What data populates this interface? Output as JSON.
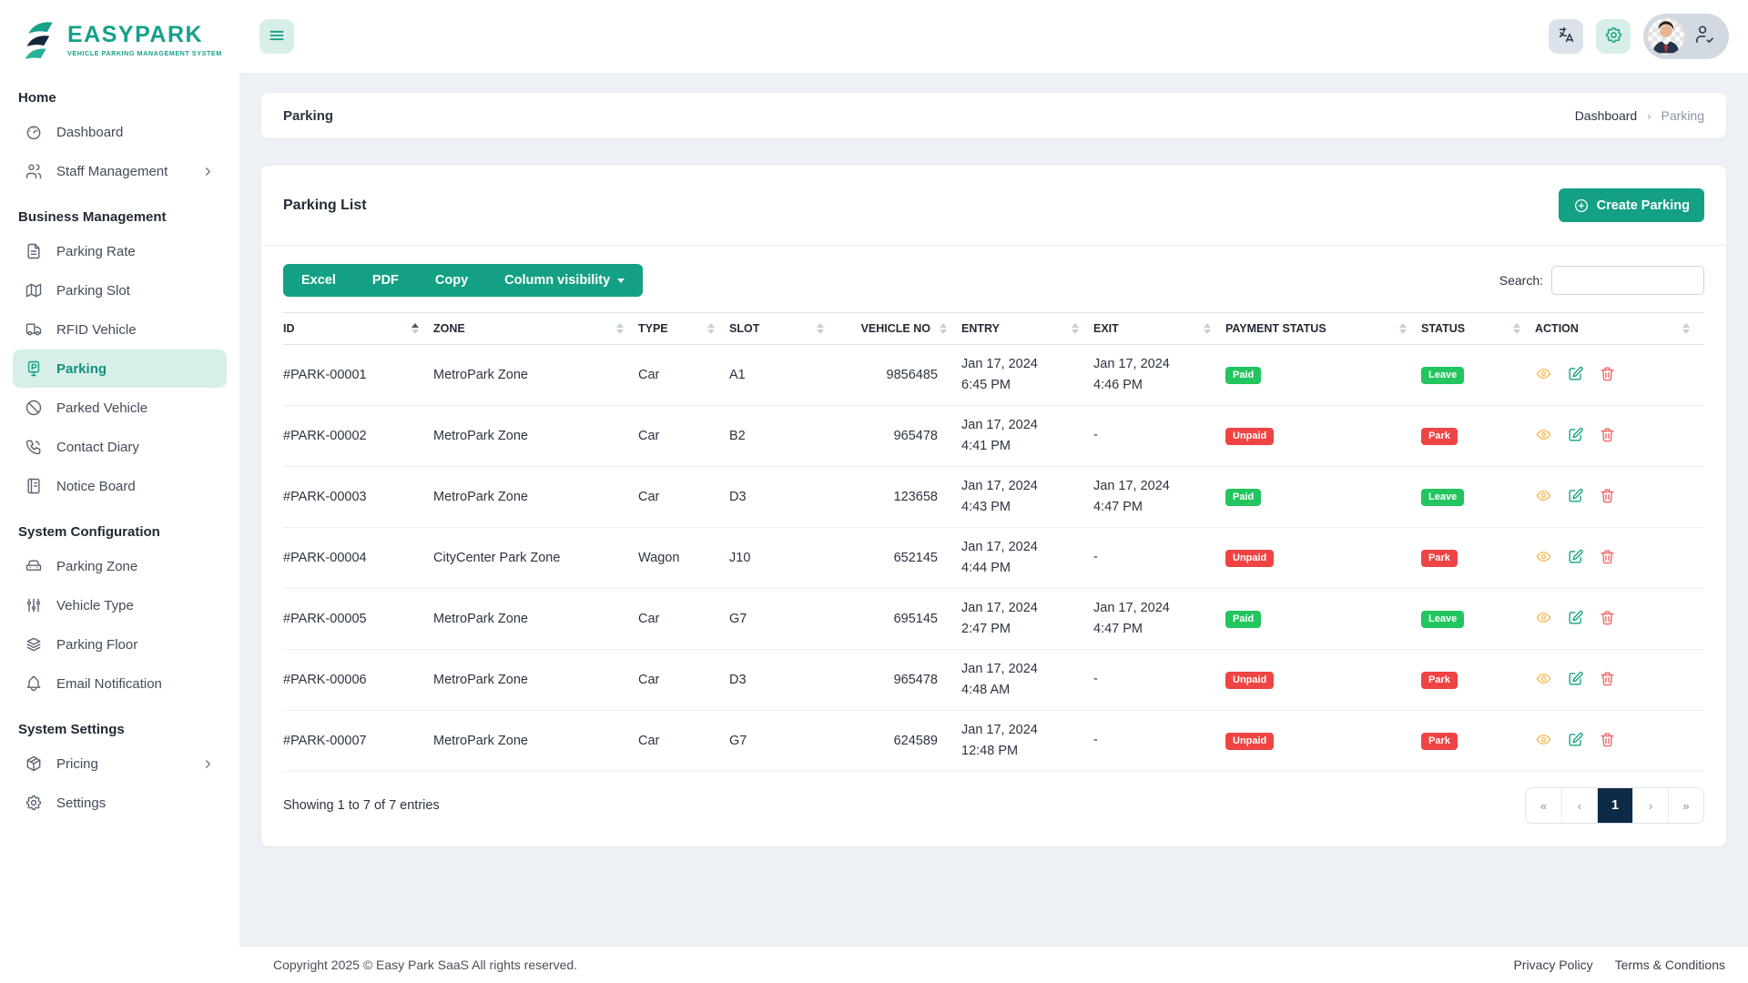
{
  "brand": {
    "name": "EASYPARK",
    "tagline": "VEHICLE PARKING MANAGEMENT SYSTEM"
  },
  "sidebar": {
    "sections": [
      {
        "label": "Home",
        "items": [
          {
            "label": "Dashboard",
            "icon": "dashboard-icon"
          },
          {
            "label": "Staff Management",
            "icon": "users-icon",
            "chevron": true
          }
        ]
      },
      {
        "label": "Business Management",
        "items": [
          {
            "label": "Parking Rate",
            "icon": "file-text-icon"
          },
          {
            "label": "Parking Slot",
            "icon": "map-icon"
          },
          {
            "label": "RFID Vehicle",
            "icon": "truck-icon"
          },
          {
            "label": "Parking",
            "icon": "parking-meter-icon",
            "active": true
          },
          {
            "label": "Parked Vehicle",
            "icon": "ban-icon"
          },
          {
            "label": "Contact Diary",
            "icon": "phone-icon"
          },
          {
            "label": "Notice Board",
            "icon": "notice-board-icon"
          }
        ]
      },
      {
        "label": "System Configuration",
        "items": [
          {
            "label": "Parking Zone",
            "icon": "car-icon"
          },
          {
            "label": "Vehicle Type",
            "icon": "sliders-icon"
          },
          {
            "label": "Parking Floor",
            "icon": "layers-icon"
          },
          {
            "label": "Email Notification",
            "icon": "bell-icon"
          }
        ]
      },
      {
        "label": "System Settings",
        "items": [
          {
            "label": "Pricing",
            "icon": "package-icon",
            "chevron": true
          },
          {
            "label": "Settings",
            "icon": "gear-icon"
          }
        ]
      }
    ]
  },
  "breadcrumb": {
    "page_title": "Parking",
    "items": [
      "Dashboard",
      "Parking"
    ]
  },
  "parking_list": {
    "title": "Parking List",
    "create_button": "Create Parking",
    "export_buttons": [
      "Excel",
      "PDF",
      "Copy"
    ],
    "column_visibility_button": "Column visibility",
    "search_label": "Search:",
    "search_value": ""
  },
  "table": {
    "columns": [
      {
        "label": "ID",
        "sorted": "asc"
      },
      {
        "label": "ZONE",
        "sorted": "none"
      },
      {
        "label": "TYPE",
        "sorted": "none"
      },
      {
        "label": "SLOT",
        "sorted": "none"
      },
      {
        "label": "VEHICLE NO",
        "sorted": "none"
      },
      {
        "label": "ENTRY",
        "sorted": "none"
      },
      {
        "label": "EXIT",
        "sorted": "none"
      },
      {
        "label": "PAYMENT STATUS",
        "sorted": "none"
      },
      {
        "label": "STATUS",
        "sorted": "none"
      },
      {
        "label": "ACTION",
        "sorted": "none"
      }
    ],
    "rows": [
      {
        "id": "#PARK-00001",
        "zone": "MetroPark Zone",
        "type": "Car",
        "slot": "A1",
        "vehicle_no": "9856485",
        "entry": [
          "Jan 17, 2024",
          "6:45 PM"
        ],
        "exit": [
          "Jan 17, 2024",
          "4:46 PM"
        ],
        "payment": "Paid",
        "status": "Leave"
      },
      {
        "id": "#PARK-00002",
        "zone": "MetroPark Zone",
        "type": "Car",
        "slot": "B2",
        "vehicle_no": "965478",
        "entry": [
          "Jan 17, 2024",
          "4:41 PM"
        ],
        "exit": [
          "-"
        ],
        "payment": "Unpaid",
        "status": "Park"
      },
      {
        "id": "#PARK-00003",
        "zone": "MetroPark Zone",
        "type": "Car",
        "slot": "D3",
        "vehicle_no": "123658",
        "entry": [
          "Jan 17, 2024",
          "4:43 PM"
        ],
        "exit": [
          "Jan 17, 2024",
          "4:47 PM"
        ],
        "payment": "Paid",
        "status": "Leave"
      },
      {
        "id": "#PARK-00004",
        "zone": "CityCenter Park Zone",
        "type": "Wagon",
        "slot": "J10",
        "vehicle_no": "652145",
        "entry": [
          "Jan 17, 2024",
          "4:44 PM"
        ],
        "exit": [
          "-"
        ],
        "payment": "Unpaid",
        "status": "Park"
      },
      {
        "id": "#PARK-00005",
        "zone": "MetroPark Zone",
        "type": "Car",
        "slot": "G7",
        "vehicle_no": "695145",
        "entry": [
          "Jan 17, 2024",
          "2:47 PM"
        ],
        "exit": [
          "Jan 17, 2024",
          "4:47 PM"
        ],
        "payment": "Paid",
        "status": "Leave"
      },
      {
        "id": "#PARK-00006",
        "zone": "MetroPark Zone",
        "type": "Car",
        "slot": "D3",
        "vehicle_no": "965478",
        "entry": [
          "Jan 17, 2024",
          "4:48 AM"
        ],
        "exit": [
          "-"
        ],
        "payment": "Unpaid",
        "status": "Park"
      },
      {
        "id": "#PARK-00007",
        "zone": "MetroPark Zone",
        "type": "Car",
        "slot": "G7",
        "vehicle_no": "624589",
        "entry": [
          "Jan 17, 2024",
          "12:48 PM"
        ],
        "exit": [
          "-"
        ],
        "payment": "Unpaid",
        "status": "Park"
      }
    ],
    "row_actions": [
      {
        "name": "view",
        "icon": "eye-icon"
      },
      {
        "name": "edit",
        "icon": "edit-icon"
      },
      {
        "name": "delete",
        "icon": "trash-icon"
      }
    ]
  },
  "table_footer": {
    "showing": "Showing 1 to 7 of 7 entries",
    "pagination": {
      "labels": [
        "«",
        "‹",
        "1",
        "›",
        "»"
      ],
      "active": "1"
    }
  },
  "page_footer": {
    "copyright": "Copyright 2025 © Easy Park SaaS All rights reserved.",
    "links": [
      "Privacy Policy",
      "Terms & Conditions"
    ]
  },
  "colors": {
    "teal": "#14a085",
    "navy": "#0d2b45",
    "sidebar_active_bg": "#d8efe9",
    "badge_green": "#22c55e",
    "badge_red": "#ef4444",
    "action_view": "#f7b84b",
    "action_edit": "#14a085",
    "action_delete": "#f06060"
  }
}
